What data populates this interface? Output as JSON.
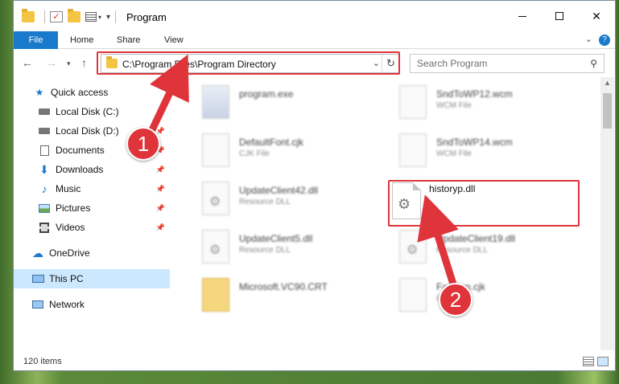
{
  "window": {
    "title": "Program"
  },
  "ribbon": {
    "tabs": [
      "File",
      "Home",
      "Share",
      "View"
    ]
  },
  "navigation": {
    "address": "C:\\Program Files\\Program Directory",
    "search_placeholder": "Search Program"
  },
  "sidebar": {
    "items": [
      {
        "label": "Quick access",
        "icon": "star-icon"
      },
      {
        "label": "Local Disk (C:)",
        "icon": "disk-icon"
      },
      {
        "label": "Local Disk (D:)",
        "icon": "disk-icon"
      },
      {
        "label": "Documents",
        "icon": "documents-icon"
      },
      {
        "label": "Downloads",
        "icon": "download-icon"
      },
      {
        "label": "Music",
        "icon": "music-icon"
      },
      {
        "label": "Pictures",
        "icon": "pictures-icon"
      },
      {
        "label": "Videos",
        "icon": "videos-icon"
      },
      {
        "label": "OneDrive",
        "icon": "cloud-icon"
      },
      {
        "label": "This PC",
        "icon": "pc-icon"
      },
      {
        "label": "Network",
        "icon": "network-icon"
      }
    ]
  },
  "files": [
    {
      "name": "program.exe",
      "type": ""
    },
    {
      "name": "SndToWP12.wcm",
      "type": "WCM File"
    },
    {
      "name": "DefaultFont.cjk",
      "type": "CJK File"
    },
    {
      "name": "SndToWP14.wcm",
      "type": "WCM File"
    },
    {
      "name": "UpdateClient42.dll",
      "type": "Resource DLL"
    },
    {
      "name": "historyp.dll",
      "type": ""
    },
    {
      "name": "UpdateClient5.dll",
      "type": "Resource DLL"
    },
    {
      "name": "UpdateClient19.dll",
      "type": "Resource DLL"
    },
    {
      "name": "Microsoft.VC90.CRT",
      "type": ""
    },
    {
      "name": "Fashion.cjk",
      "type": "CJK File"
    }
  ],
  "status": {
    "item_count": "120 items"
  },
  "annotations": {
    "step1": "1",
    "step2": "2",
    "color": "#e0343b"
  }
}
